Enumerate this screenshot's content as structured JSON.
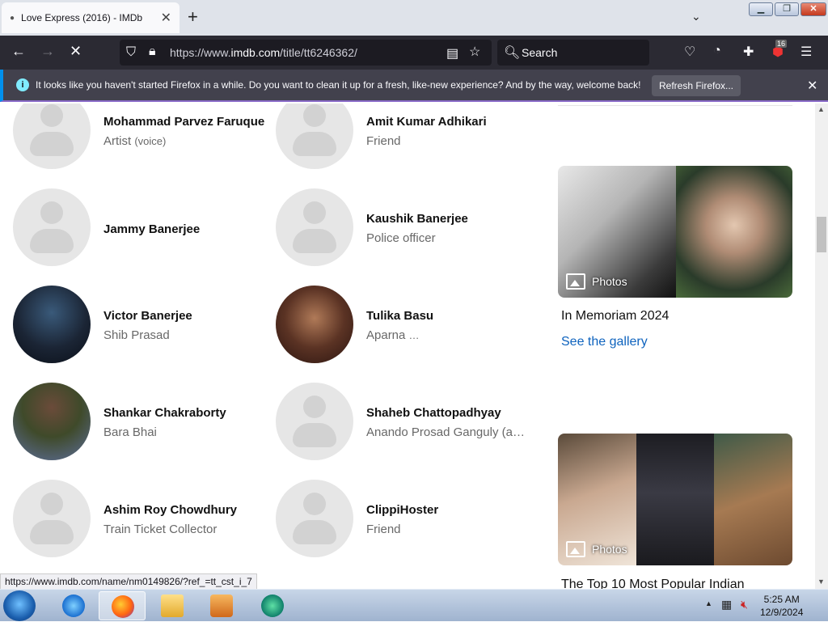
{
  "browser": {
    "tab_title": "Love Express (2016) - IMDb",
    "url_prefix": "https://www.",
    "url_host": "imdb.com",
    "url_path": "/title/tt6246362/",
    "search_placeholder": "Search",
    "extension_badge": "16",
    "notification": "It looks like you haven't started Firefox in a while. Do you want to clean it up for a fresh, like-new experience? And by the way, welcome back!",
    "refresh_label": "Refresh Firefox...",
    "status_url": "https://www.imdb.com/name/nm0149826/?ref_=tt_cst_i_7"
  },
  "cast": [
    {
      "name": "Mohammad Parvez Faruque",
      "role": "Artist",
      "role_note": "(voice)",
      "photo": "placeholder"
    },
    {
      "name": "Amit Kumar Adhikari",
      "role": "Friend",
      "role_note": "",
      "photo": "placeholder"
    },
    {
      "name": "Jammy Banerjee",
      "role": "",
      "role_note": "",
      "photo": "placeholder"
    },
    {
      "name": "Kaushik Banerjee",
      "role": "Police officer",
      "role_note": "",
      "photo": "placeholder"
    },
    {
      "name": "Victor Banerjee",
      "role": "Shib Prasad",
      "role_note": "",
      "photo": "photo1"
    },
    {
      "name": "Tulika Basu",
      "role": "Aparna",
      "role_note": "…",
      "photo": "photo2"
    },
    {
      "name": "Shankar Chakraborty",
      "role": "Bara Bhai",
      "role_note": "",
      "photo": "photo3"
    },
    {
      "name": "Shaheb Chattopadhyay",
      "role": "Anando Prosad Ganguly (a…",
      "role_note": "",
      "photo": "placeholder"
    },
    {
      "name": "Ashim Roy Chowdhury",
      "role": "Train Ticket Collector",
      "role_note": "",
      "photo": "placeholder"
    },
    {
      "name": "ClippiHoster",
      "role": "Friend",
      "role_note": "",
      "photo": "placeholder"
    }
  ],
  "sidebar": {
    "card1_label": "Photos",
    "card1_title": "In Memoriam 2024",
    "card1_link": "See the gallery",
    "card2_label": "Photos",
    "card2_title": "The Top 10 Most Popular Indian"
  },
  "taskbar": {
    "time": "5:25 AM",
    "date": "12/9/2024"
  }
}
